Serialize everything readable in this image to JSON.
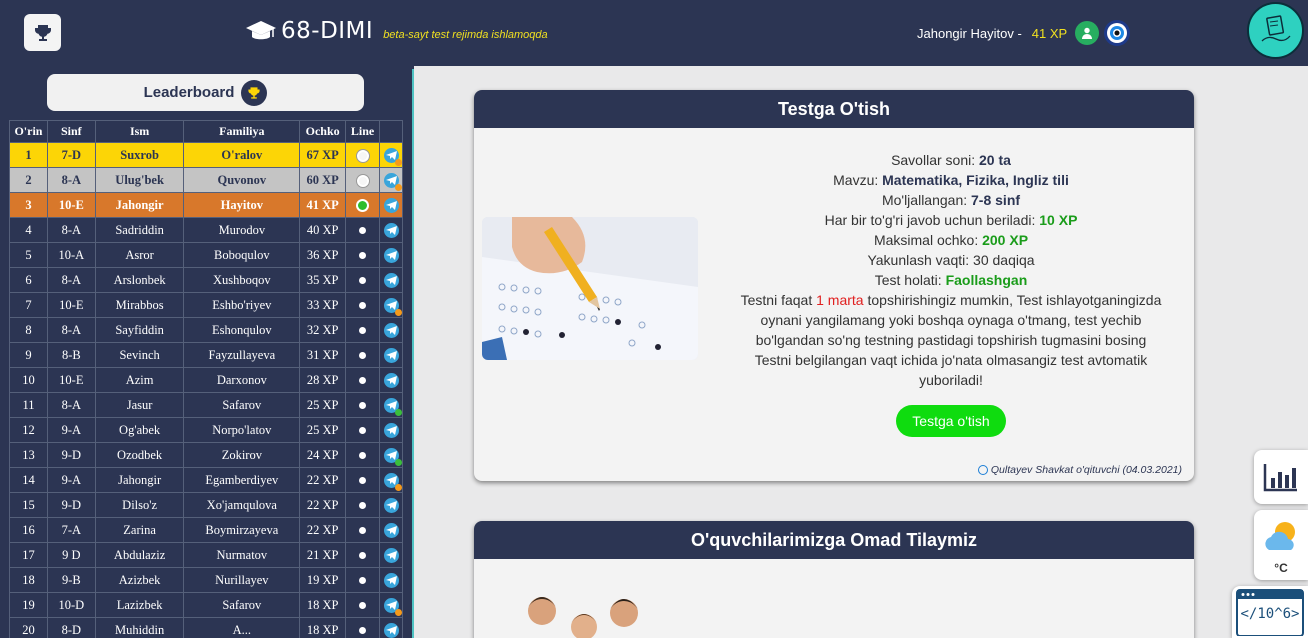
{
  "header": {
    "brand_title": "68-DIMI",
    "beta_text": "beta-sayt test rejimda ishlamoqda",
    "user_name": "Jahongir Hayitov -",
    "user_xp": "41 XP"
  },
  "sidebar": {
    "leaderboard_label": "Leaderboard",
    "columns": [
      "O'rin",
      "Sinf",
      "Ism",
      "Familiya",
      "Ochko",
      "Line"
    ],
    "rows": [
      {
        "rank": "1",
        "sinf": "7-D",
        "ism": "Suxrob",
        "familiya": "O'ralov",
        "ochko": "67 XP"
      },
      {
        "rank": "2",
        "sinf": "8-A",
        "ism": "Ulug'bek",
        "familiya": "Quvonov",
        "ochko": "60 XP"
      },
      {
        "rank": "3",
        "sinf": "10-E",
        "ism": "Jahongir",
        "familiya": "Hayitov",
        "ochko": "41 XP"
      },
      {
        "rank": "4",
        "sinf": "8-A",
        "ism": "Sadriddin",
        "familiya": "Murodov",
        "ochko": "40 XP"
      },
      {
        "rank": "5",
        "sinf": "10-A",
        "ism": "Asror",
        "familiya": "Boboqulov",
        "ochko": "36 XP"
      },
      {
        "rank": "6",
        "sinf": "8-A",
        "ism": "Arslonbek",
        "familiya": "Xushboqov",
        "ochko": "35 XP"
      },
      {
        "rank": "7",
        "sinf": "10-E",
        "ism": "Mirabbos",
        "familiya": "Eshbo'riyev",
        "ochko": "33 XP"
      },
      {
        "rank": "8",
        "sinf": "8-A",
        "ism": "Sayfiddin",
        "familiya": "Eshonqulov",
        "ochko": "32 XP"
      },
      {
        "rank": "9",
        "sinf": "8-B",
        "ism": "Sevinch",
        "familiya": "Fayzullayeva",
        "ochko": "31 XP"
      },
      {
        "rank": "10",
        "sinf": "10-E",
        "ism": "Azim",
        "familiya": "Darxonov",
        "ochko": "28 XP"
      },
      {
        "rank": "11",
        "sinf": "8-A",
        "ism": "Jasur",
        "familiya": "Safarov",
        "ochko": "25 XP"
      },
      {
        "rank": "12",
        "sinf": "9-A",
        "ism": "Og'abek",
        "familiya": "Norpo'latov",
        "ochko": "25 XP"
      },
      {
        "rank": "13",
        "sinf": "9-D",
        "ism": "Ozodbek",
        "familiya": "Zokirov",
        "ochko": "24 XP"
      },
      {
        "rank": "14",
        "sinf": "9-A",
        "ism": "Jahongir",
        "familiya": "Egamberdiyev",
        "ochko": "22 XP"
      },
      {
        "rank": "15",
        "sinf": "9-D",
        "ism": "Dilso'z",
        "familiya": "Xo'jamqulova",
        "ochko": "22 XP"
      },
      {
        "rank": "16",
        "sinf": "7-A",
        "ism": "Zarina",
        "familiya": "Boymirzayeva",
        "ochko": "22 XP"
      },
      {
        "rank": "17",
        "sinf": "9 D",
        "ism": "Abdulaziz",
        "familiya": "Nurmatov",
        "ochko": "21 XP"
      },
      {
        "rank": "18",
        "sinf": "9-B",
        "ism": "Azizbek",
        "familiya": "Nurillayev",
        "ochko": "19 XP"
      },
      {
        "rank": "19",
        "sinf": "10-D",
        "ism": "Lazizbek",
        "familiya": "Safarov",
        "ochko": "18 XP"
      },
      {
        "rank": "20",
        "sinf": "8-D",
        "ism": "Muhiddin",
        "familiya": "A...",
        "ochko": "18 XP"
      }
    ]
  },
  "test_card": {
    "title": "Testga O'tish",
    "savollar_label": "Savollar soni:",
    "savollar_value": "20 ta",
    "mavzu_label": "Mavzu:",
    "mavzu_value": "Matematika, Fizika, Ingliz tili",
    "moljal_label": "Mo'ljallangan:",
    "moljal_value": "7-8 sinf",
    "ball_label": "Har bir to'g'ri javob uchun beriladi:",
    "ball_value": "10 XP",
    "max_label": "Maksimal ochko:",
    "max_value": "200 XP",
    "vaqt_text": "Yakunlash vaqti: 30 daqiqa",
    "holat_label": "Test holati:",
    "holat_value": "Faollashgan",
    "note_part1": "Testni faqat",
    "note_highlight": "1 marta",
    "note_part2": "topshirishingiz mumkin, Test ishlayotganingizda oynani yangilamang yoki boshqa oynaga o'tmang, test yechib bo'lgandan so'ng testning pastidagi topshirish tugmasini bosing Testni belgilangan vaqt ichida jo'nata olmasangiz test avtomatik yuboriladi!",
    "button_label": "Testga o'tish",
    "author": "Qultayev Shavkat o'qituvchi (04.03.2021)"
  },
  "wish_card": {
    "title": "O'quvchilarimizga Omad Tilaymiz"
  },
  "widgets": {
    "weather_unit": "°C",
    "code_label": "</10^6>"
  },
  "colors": {
    "navy": "#2c3553",
    "gold": "#fcd506",
    "silver": "#c4c4c4",
    "bronze": "#d8782b",
    "green": "#0fdc0f"
  }
}
